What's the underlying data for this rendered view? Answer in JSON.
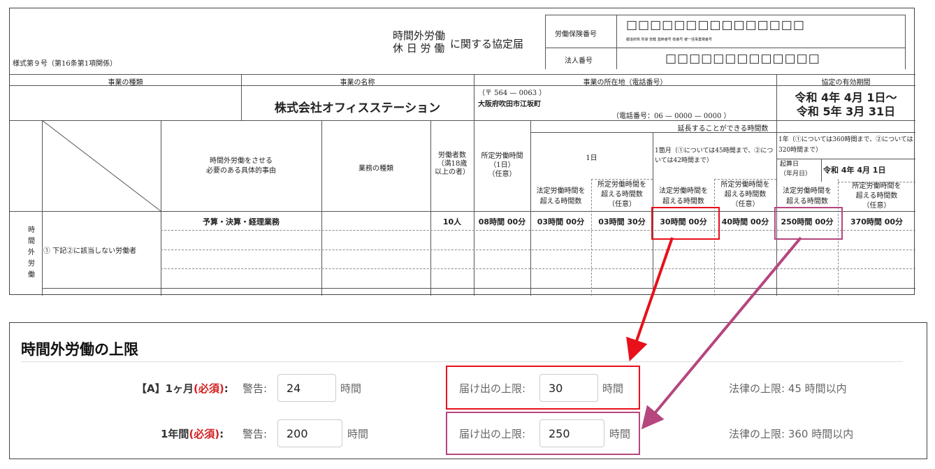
{
  "form": {
    "title_line1": "時間外労働",
    "title_line2": "休 日 労 働",
    "title_suffix": "に関する協定届",
    "form_number": "様式第９号（第16条第1項関係）",
    "insurance_label": "労働保険番号",
    "insurance_boxes": "□□□□□□□□□□□□□□□",
    "insurance_sub": "都道府県 所掌 管轄 基幹番号 枝番号 被一括事業場番号",
    "corp_label": "法人番号",
    "corp_boxes": "□□□□□□□□□□□□□",
    "col_business_type": "事業の種類",
    "col_business_name": "事業の名称",
    "col_location": "事業の所在地（電話番号）",
    "col_validity": "協定の有効期間",
    "business_type_value": "",
    "business_name_value": "株式会社オフィスステーション",
    "postal": "（〒  564  —  0063  ）",
    "address": "大阪府吹田市江坂町",
    "phone": "（電話番号：06  —  0000  —  0000 ）",
    "validity_from": "令和 4年 4月 1日～",
    "validity_to": "令和 5年 3月 31日",
    "side_label": "時間外労働",
    "h_reason": "時間外労働をさせる\n必要のある具体的事由",
    "h_job": "業務の種類",
    "h_workers": "労働者数\n（満18歳\n以上の者）",
    "h_fixed": "所定労働時間\n（1日）\n（任意）",
    "h_extendable": "延長することができる時間数",
    "h_day": "1日",
    "h_month": "1箇月（①については45時間まで、②については42時間まで）",
    "h_year": "1年（①については360時間まで、②については320時間まで）",
    "h_start_label": "起算日\n（年月日）",
    "h_start_value": "令和 4年 4月 1日",
    "h_legal_over": "法定労働時間を\n超える時間数",
    "h_fixed_over": "所定労働時間を\n超える時間数\n（任意）",
    "row_category": "① 下記②に該当しない労働者",
    "row": {
      "reason": "予算・決算・経理業務",
      "workers": "10人",
      "fixed": "08時間 00分",
      "day_legal": "03時間 00分",
      "day_fixed": "03時間 30分",
      "month_legal": "30時間 00分",
      "month_fixed": "40時間 00分",
      "year_legal": "250時間 00分",
      "year_fixed": "370時間 00分"
    }
  },
  "panel": {
    "title": "時間外労働の上限",
    "rows": [
      {
        "label_prefix": "【A】1ヶ月",
        "required": "(必須)",
        "colon": ":",
        "warning_label": "警告:",
        "warning_value": "24",
        "unit": "時間",
        "limit_label": "届け出の上限:",
        "limit_value": "30",
        "legal": "法律の上限: 45 時間以内"
      },
      {
        "label_prefix": "1年間",
        "required": "(必須)",
        "colon": ":",
        "warning_label": "警告:",
        "warning_value": "200",
        "unit": "時間",
        "limit_label": "届け出の上限:",
        "limit_value": "250",
        "legal": "法律の上限: 360 時間以内"
      }
    ]
  },
  "colors": {
    "red": "#e8101b",
    "magenta": "#b5467e",
    "required": "#d21f1f"
  }
}
